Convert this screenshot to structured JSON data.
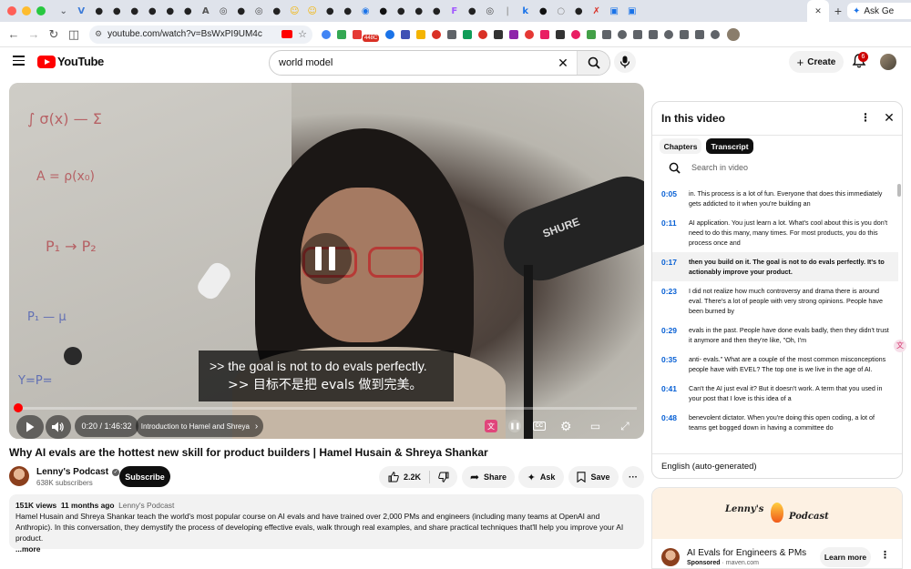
{
  "browser": {
    "url": "youtube.com/watch?v=BsWxPI9UM4c",
    "tab_favicons": [
      {
        "icon": "chevron-down",
        "color": "#5f6368",
        "glyph": "⌄"
      },
      {
        "icon": "vercel-v",
        "color": "#3c7bd8",
        "glyph": "V"
      },
      {
        "icon": "github",
        "color": "#222222",
        "glyph": "●"
      },
      {
        "icon": "github",
        "color": "#222222",
        "glyph": "●"
      },
      {
        "icon": "github",
        "color": "#222222",
        "glyph": "●"
      },
      {
        "icon": "github",
        "color": "#222222",
        "glyph": "●"
      },
      {
        "icon": "github",
        "color": "#222222",
        "glyph": "●"
      },
      {
        "icon": "github",
        "color": "#222222",
        "glyph": "●"
      },
      {
        "icon": "anthropic-ai",
        "color": "#555555",
        "glyph": "A"
      },
      {
        "icon": "openai",
        "color": "#444444",
        "glyph": "◎"
      },
      {
        "icon": "github",
        "color": "#222222",
        "glyph": "●"
      },
      {
        "icon": "openai",
        "color": "#444444",
        "glyph": "◎"
      },
      {
        "icon": "github",
        "color": "#222222",
        "glyph": "●"
      },
      {
        "icon": "huggingface",
        "color": "#f4b400",
        "glyph": "☺"
      },
      {
        "icon": "huggingface",
        "color": "#f4b400",
        "glyph": "☺"
      },
      {
        "icon": "github",
        "color": "#222222",
        "glyph": "●"
      },
      {
        "icon": "github",
        "color": "#222222",
        "glyph": "●"
      },
      {
        "icon": "globe",
        "color": "#1a73e8",
        "glyph": "◉"
      },
      {
        "icon": "dark-circle",
        "color": "#111111",
        "glyph": "●"
      },
      {
        "icon": "github",
        "color": "#222222",
        "glyph": "●"
      },
      {
        "icon": "github",
        "color": "#222222",
        "glyph": "●"
      },
      {
        "icon": "github",
        "color": "#222222",
        "glyph": "●"
      },
      {
        "icon": "figma",
        "color": "#a259ff",
        "glyph": "F"
      },
      {
        "icon": "github",
        "color": "#222222",
        "glyph": "●"
      },
      {
        "icon": "openai",
        "color": "#444444",
        "glyph": "◎"
      },
      {
        "icon": "separator",
        "color": "#999999",
        "glyph": "|"
      },
      {
        "icon": "k-logo",
        "color": "#1a73e8",
        "glyph": "k"
      },
      {
        "icon": "dark-circle",
        "color": "#111111",
        "glyph": "●"
      },
      {
        "icon": "loading",
        "color": "#888888",
        "glyph": "○"
      },
      {
        "icon": "github",
        "color": "#222222",
        "glyph": "●"
      },
      {
        "icon": "x-red",
        "color": "#d93025",
        "glyph": "✗"
      },
      {
        "icon": "tab-group",
        "color": "#1a73e8",
        "glyph": "▣"
      },
      {
        "icon": "tab-group",
        "color": "#1a73e8",
        "glyph": "▣"
      }
    ],
    "active_tab_close": "✕",
    "new_tab": "+",
    "ask_label": "Ask Ge",
    "extensions": [
      "#4285f4",
      "#34a853",
      "#e53935",
      "#1a73e8",
      "#3f51b5",
      "#f4b400",
      "#d93025",
      "#5f6368",
      "#0f9d58",
      "#d93025",
      "#333333",
      "#8e24aa",
      "#e53935",
      "#e91e63",
      "#333333",
      "#e91e63",
      "#43a047",
      "#5f6368",
      "#5f6368",
      "#5f6368",
      "#5f6368",
      "#5f6368",
      "#5f6368",
      "#5f6368",
      "#5f6368"
    ],
    "ext_badge": "448C"
  },
  "header": {
    "logo_text": "YouTube",
    "search_query": "world model",
    "create_label": "Create",
    "notification_count": "6"
  },
  "player": {
    "caption_en": ">> the goal is not to do evals perfectly.",
    "caption_zh": ">> 目标不是把 evals 做到完美。",
    "time": "0:20 / 1:46:32",
    "chapter": "Introduction to Hamel and Shreya",
    "progress_fraction": 0.0031,
    "state": "playing"
  },
  "video": {
    "title": "Why AI evals are the hottest new skill for product builders | Hamel Husain & Shreya Shankar",
    "channel": "Lenny's Podcast",
    "subscribers": "638K subscribers",
    "subscribe_label": "Subscribe",
    "likes": "2.2K",
    "share_label": "Share",
    "ask_label": "Ask",
    "save_label": "Save",
    "more_label": "···"
  },
  "description": {
    "views": "151K views",
    "age": "11 months ago",
    "channel_tag": "Lenny's Podcast",
    "text": "Hamel Husain and Shreya Shankar teach the world's most popular course on AI evals and have trained over 2,000 PMs and engineers (including many teams at OpenAI and Anthropic). In this conversation, they demystify the process of developing effective evals, walk through real examples, and share practical techniques that'll help you improve your AI product.",
    "more": "...more"
  },
  "transcript": {
    "title": "In this video",
    "chip_chapters": "Chapters",
    "chip_transcript": "Transcript",
    "search_placeholder": "Search in video",
    "active_index": 2,
    "segments": [
      {
        "time": "0:05",
        "text": "in. This process is a lot of fun. Everyone that does this immediately gets addicted to it when you're building an"
      },
      {
        "time": "0:11",
        "text": "AI application. You just learn a lot. What's cool about this is you don't need to do this many, many times. For most products, you do this process once and"
      },
      {
        "time": "0:17",
        "text": "then you build on it. The goal is not to do evals perfectly. It's to actionably improve your product."
      },
      {
        "time": "0:23",
        "text": "I did not realize how much controversy and drama there is around eval. There's a lot of people with very strong opinions. People have been burned by"
      },
      {
        "time": "0:29",
        "text": "evals in the past. People have done evals badly, then they didn't trust it anymore and then they're like, \"Oh, I'm"
      },
      {
        "time": "0:35",
        "text": "anti- evals.\" What are a couple of the most common misconceptions people have with EVEL? The top one is we live in the age of AI."
      },
      {
        "time": "0:41",
        "text": "Can't the AI just eval it? But it doesn't work. A term that you used in your post that I love is this idea of a"
      },
      {
        "time": "0:48",
        "text": "benevolent dictator. When you're doing this open coding, a lot of teams get bogged down in having a committee do"
      }
    ],
    "language": "English (auto-generated)"
  },
  "ad": {
    "brand_left": "Lenny's",
    "brand_right": "Podcast",
    "title": "AI Evals for Engineers & PMs",
    "sponsored": "Sponsored",
    "domain": "maven.com",
    "cta": "Learn more"
  }
}
